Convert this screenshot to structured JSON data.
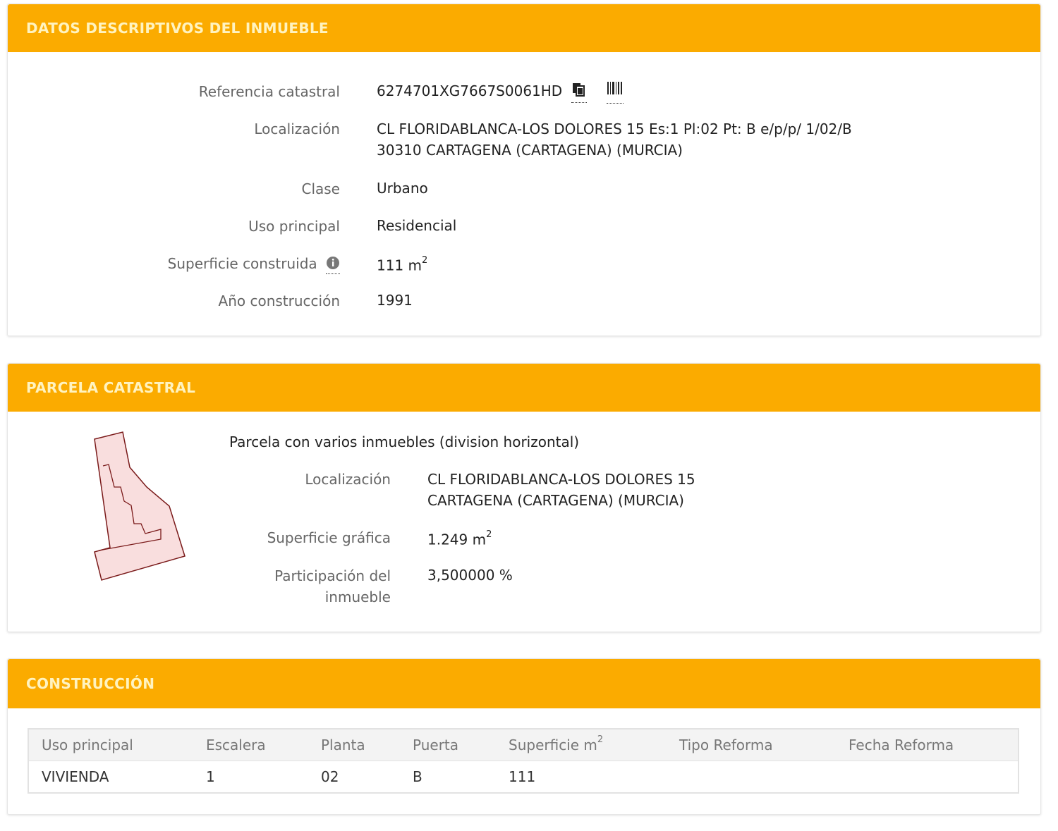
{
  "panel1": {
    "title": "DATOS DESCRIPTIVOS DEL INMUEBLE",
    "fields": [
      {
        "label": "Referencia catastral",
        "value": "6274701XG7667S0061HD"
      },
      {
        "label": "Localización",
        "value_line1": "CL FLORIDABLANCA-LOS DOLORES 15 Es:1 Pl:02 Pt: B e/p/p/ 1/02/B",
        "value_line2": "30310 CARTAGENA (CARTAGENA) (MURCIA)"
      },
      {
        "label": "Clase",
        "value": "Urbano"
      },
      {
        "label": "Uso principal",
        "value": "Residencial"
      },
      {
        "label": "Superficie construida",
        "value": "111 m",
        "unit_sup": "2"
      },
      {
        "label": "Año construcción",
        "value": "1991"
      }
    ],
    "icons": [
      "copy-icon",
      "barcode-icon",
      "info-icon"
    ]
  },
  "panel2": {
    "title": "PARCELA CATASTRAL",
    "subtitle": "Parcela con varios inmuebles (division horizontal)",
    "fields": [
      {
        "label": "Localización",
        "value_line1": "CL FLORIDABLANCA-LOS DOLORES 15",
        "value_line2": "CARTAGENA (CARTAGENA) (MURCIA)"
      },
      {
        "label": "Superficie gráfica",
        "value": "1.249 m",
        "unit_sup": "2"
      },
      {
        "label_line1": "Participación del",
        "label_line2": "inmueble",
        "value": "3,500000 %"
      }
    ],
    "parcel_shape_colors": {
      "fill": "#f9dede",
      "stroke": "#7a1a1a"
    }
  },
  "panel3": {
    "title": "CONSTRUCCIÓN",
    "table": {
      "headers": [
        "Uso principal",
        "Escalera",
        "Planta",
        "Puerta",
        "Superficie m",
        "Tipo Reforma",
        "Fecha Reforma"
      ],
      "header_sup": "2",
      "rows": [
        [
          "VIVIENDA",
          "1",
          "02",
          "B",
          "111",
          "",
          ""
        ]
      ]
    }
  },
  "colors": {
    "header_bg": "#fbab00",
    "header_text": "#fff3c0"
  }
}
